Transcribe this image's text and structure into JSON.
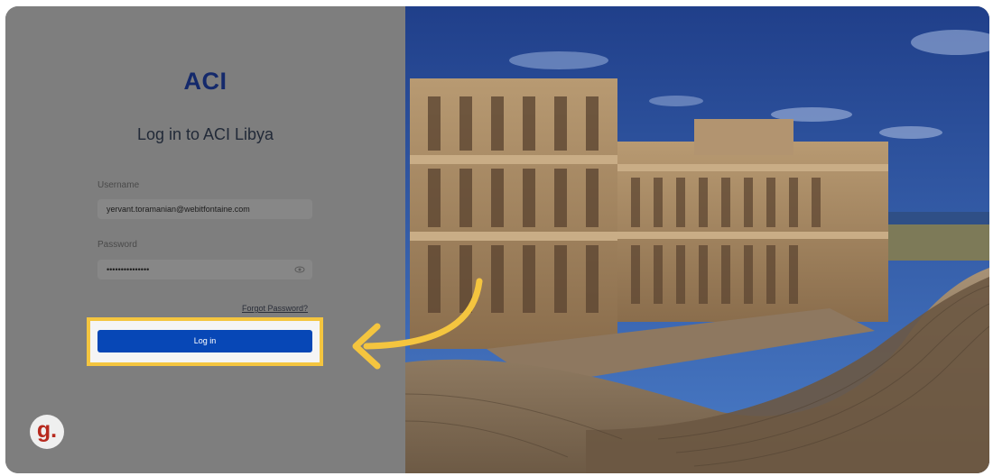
{
  "login": {
    "logo_text": "ACI",
    "title": "Log in to ACI Libya",
    "username_label": "Username",
    "username_value": "yervant.toramanian@webitfontaine.com",
    "password_label": "Password",
    "password_value": "•••••••••••••••",
    "forgot_password": "Forgot Password?",
    "login_button": "Log in"
  },
  "badge": {
    "letter": "g."
  },
  "colors": {
    "brand_navy": "#14296b",
    "button_blue": "#0747b6",
    "highlight_yellow": "#f4c53f",
    "badge_red": "#b7291e"
  },
  "icons": [
    "eye-icon",
    "arrow-annotation"
  ]
}
